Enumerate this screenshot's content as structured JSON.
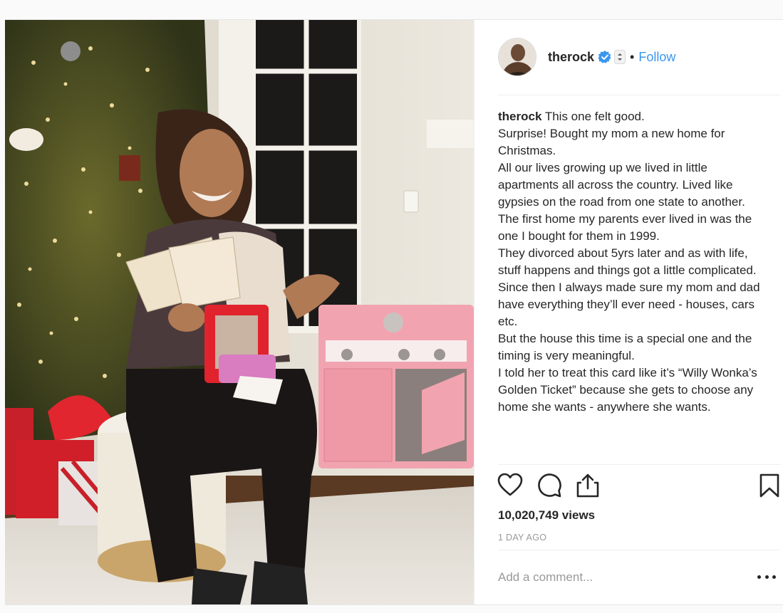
{
  "post": {
    "username": "therock",
    "follow_label": "Follow",
    "separator": "•",
    "caption_user": "therock",
    "caption_lines": [
      "This one felt good.",
      "Surprise! Bought my mom a new home for Christmas.",
      "All our lives growing up we lived in little apartments all across the country. Lived like gypsies on the road from one state to another.",
      "The first home my parents ever lived in was the one I bought for them in 1999.",
      "They divorced about 5yrs later and as with life, stuff happens and things got a little complicated.",
      "Since then I always made sure my mom and dad have everything they’ll ever need - houses, cars etc.",
      "But the house this time is a special one and the timing is very meaningful.",
      "I told her to treat this card like it’s “Willy Wonka’s Golden Ticket” because she gets to choose any home she wants - anywhere she wants."
    ],
    "views": "10,020,749 views",
    "time_ago": "1 DAY AGO",
    "comment_placeholder": "Add a comment..."
  },
  "icons": {
    "verified": "verified-badge-icon",
    "sort": "sort-arrows-icon",
    "like": "heart-icon",
    "comment": "comment-bubble-icon",
    "share": "share-icon",
    "save": "bookmark-icon",
    "more": "more-options-icon"
  },
  "colors": {
    "accent": "#3897f0",
    "text": "#262626",
    "muted": "#999999",
    "divider": "#efefef"
  }
}
